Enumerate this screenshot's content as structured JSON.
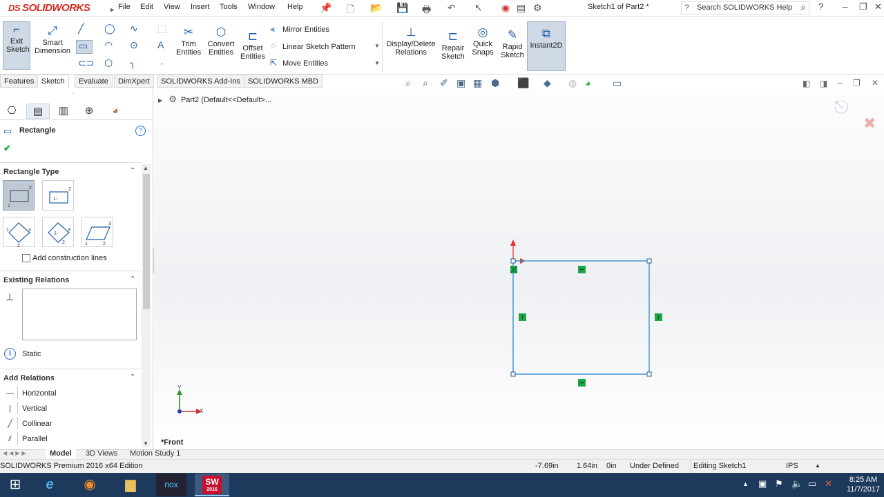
{
  "app": {
    "brand": "SOLIDWORKS",
    "brand_prefix": "DS",
    "doc_title": "Sketch1 of Part2 *"
  },
  "menu": [
    "File",
    "Edit",
    "View",
    "Insert",
    "Tools",
    "Window",
    "Help"
  ],
  "search": {
    "placeholder": "Search SOLIDWORKS Help"
  },
  "ribbon": {
    "exit_sketch": "Exit Sketch",
    "smart_dimension": "Smart Dimension",
    "trim_entities": "Trim Entities",
    "convert_entities": "Convert Entities",
    "offset_entities": "Offset Entities",
    "mirror_entities": "Mirror Entities",
    "linear_sketch_pattern": "Linear Sketch Pattern",
    "move_entities": "Move Entities",
    "display_delete_relations": "Display/Delete Relations",
    "repair_sketch": "Repair Sketch",
    "quick_snaps": "Quick Snaps",
    "rapid_sketch": "Rapid Sketch",
    "instant2d": "Instant2D"
  },
  "tabs": [
    "Features",
    "Sketch",
    "Evaluate",
    "DimXpert",
    "SOLIDWORKS Add-Ins",
    "SOLIDWORKS MBD"
  ],
  "active_tab": "Sketch",
  "property_manager": {
    "title": "Rectangle",
    "rectangle_type": "Rectangle Type",
    "add_construction_lines": "Add construction lines",
    "existing_relations": "Existing Relations",
    "static_label": "Static",
    "add_relations": "Add Relations",
    "relations": [
      "Horizontal",
      "Vertical",
      "Collinear",
      "Parallel"
    ]
  },
  "tree": {
    "part_label": "Part2  (Default<<Default>..."
  },
  "viewport": {
    "view_label": "*Front",
    "axis_x": "X",
    "axis_y": "Y",
    "sketch_color": "#3a8fd6",
    "relation_color": "#1aa84a"
  },
  "bottom_tabs": [
    "Model",
    "3D Views",
    "Motion Study 1"
  ],
  "status": {
    "edition": "SOLIDWORKS Premium 2016 x64 Edition",
    "x": "-7.69in",
    "y": "1.64in",
    "z": "0in",
    "state": "Under Defined",
    "editing": "Editing Sketch1",
    "units": "IPS"
  },
  "taskbar": {
    "time": "8:25 AM",
    "date": "11/7/2017",
    "sw_label": "SW",
    "sw_year": "2016",
    "nox_label": "nox"
  }
}
